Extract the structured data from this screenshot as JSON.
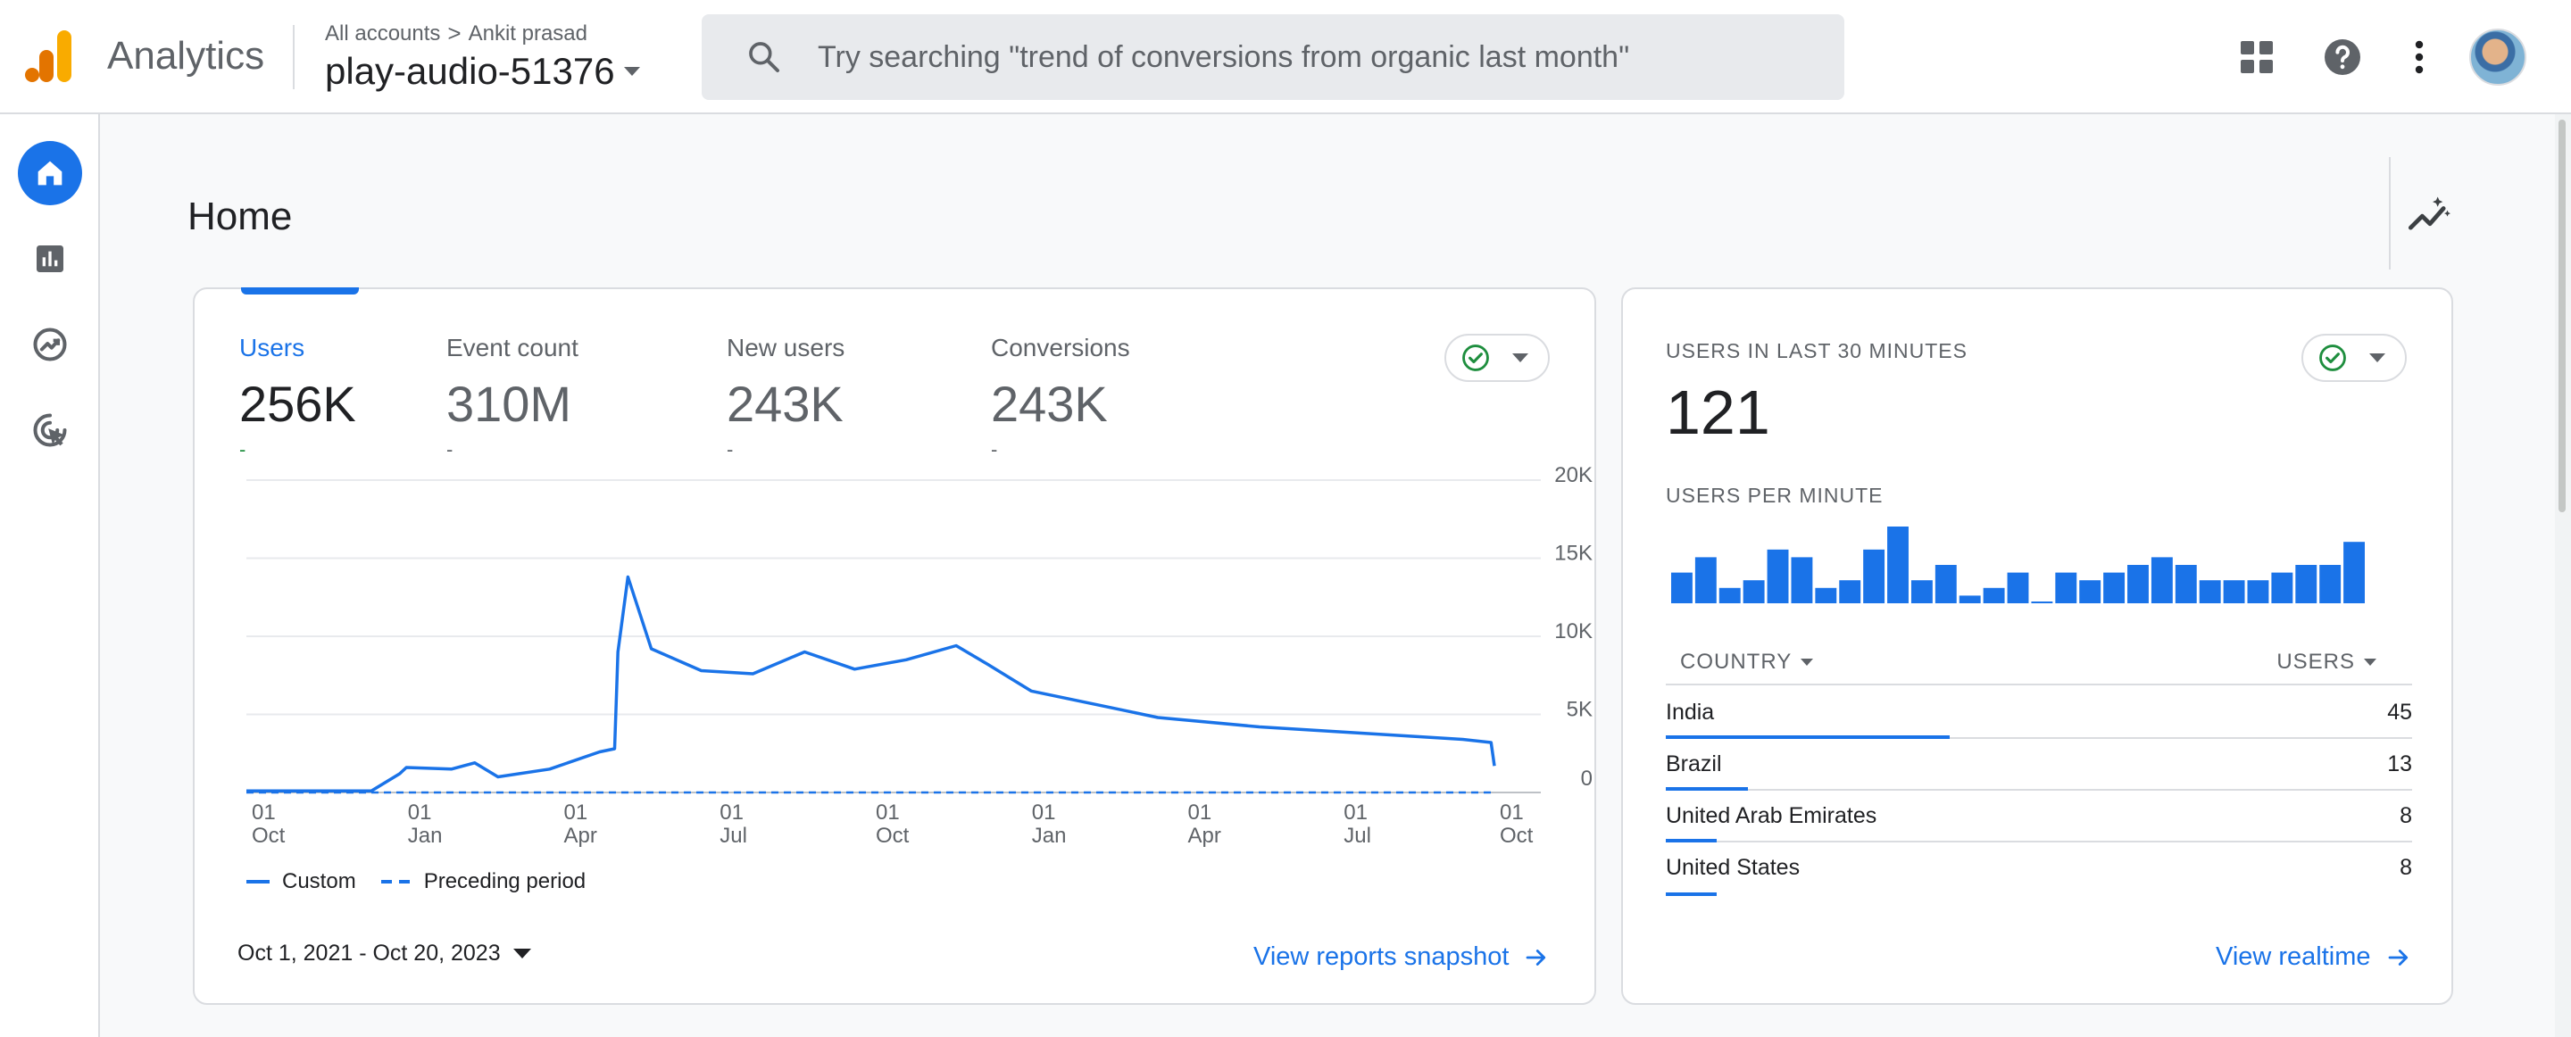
{
  "header": {
    "app_name": "Analytics",
    "breadcrumb": {
      "account": "All accounts",
      "separator": ">",
      "user": "Ankit prasad"
    },
    "property_name": "play-audio-51376",
    "search_placeholder": "Try searching \"trend of conversions from organic last month\"",
    "icons": [
      "apps-grid-icon",
      "help-icon",
      "more-vert-icon",
      "avatar"
    ]
  },
  "rail": {
    "items": [
      {
        "name": "home",
        "icon": "home-icon",
        "active": true
      },
      {
        "name": "reports",
        "icon": "bar-chart-icon",
        "active": false
      },
      {
        "name": "explore",
        "icon": "explore-trend-icon",
        "active": false
      },
      {
        "name": "advertising",
        "icon": "ads-target-icon",
        "active": false
      }
    ]
  },
  "page": {
    "title": "Home"
  },
  "main_card": {
    "metrics": [
      {
        "label": "Users",
        "value": "256K",
        "delta": "-",
        "active": true
      },
      {
        "label": "Event count",
        "value": "310M",
        "delta": "-",
        "active": false
      },
      {
        "label": "New users",
        "value": "243K",
        "delta": "-",
        "active": false
      },
      {
        "label": "Conversions",
        "value": "243K",
        "delta": "-",
        "active": false
      }
    ],
    "legend": {
      "current": "Custom",
      "previous": "Preceding period"
    },
    "date_range": "Oct 1, 2021 - Oct 20, 2023",
    "link": "View reports snapshot"
  },
  "chart_data": {
    "type": "line",
    "title": "",
    "xlabel": "",
    "ylabel": "",
    "x_tick_labels": [
      [
        "01",
        "Oct"
      ],
      [
        "01",
        "Jan"
      ],
      [
        "01",
        "Apr"
      ],
      [
        "01",
        "Jul"
      ],
      [
        "01",
        "Oct"
      ],
      [
        "01",
        "Jan"
      ],
      [
        "01",
        "Apr"
      ],
      [
        "01",
        "Jul"
      ],
      [
        "01",
        "Oct"
      ]
    ],
    "y_tick_labels": [
      "20K",
      "15K",
      "10K",
      "5K",
      "0"
    ],
    "ylim": [
      0,
      20000
    ],
    "grid": true,
    "y_axis_position": "right",
    "legend_position": "bottom-left",
    "series": [
      {
        "name": "Custom",
        "style": "solid",
        "x": [
          "2021-10-01",
          "2021-12-15",
          "2022-01-01",
          "2022-01-05",
          "2022-02-01",
          "2022-02-15",
          "2022-03-01",
          "2022-04-01",
          "2022-05-01",
          "2022-05-10",
          "2022-05-12",
          "2022-05-18",
          "2022-06-01",
          "2022-07-01",
          "2022-08-01",
          "2022-09-01",
          "2022-10-01",
          "2022-11-01",
          "2022-12-01",
          "2022-12-20",
          "2023-01-15",
          "2023-03-01",
          "2023-04-01",
          "2023-06-01",
          "2023-08-01",
          "2023-10-01",
          "2023-10-18",
          "2023-10-20"
        ],
        "values": [
          100,
          100,
          1200,
          1600,
          1500,
          1900,
          1000,
          1500,
          2600,
          2800,
          9000,
          13800,
          9200,
          7800,
          7600,
          9000,
          7900,
          8500,
          9400,
          8200,
          6500,
          5500,
          4800,
          4200,
          3800,
          3400,
          3200,
          1700
        ]
      },
      {
        "name": "Preceding period",
        "style": "dashed",
        "x": [
          "2021-10-01",
          "2023-10-20"
        ],
        "values": [
          0,
          0
        ]
      }
    ]
  },
  "realtime": {
    "title": "USERS IN LAST 30 MINUTES",
    "value": "121",
    "per_minute_label": "USERS PER MINUTE",
    "per_minute_values": [
      4,
      6,
      2,
      3,
      7,
      6,
      2,
      3,
      7,
      10,
      3,
      5,
      1,
      2,
      4,
      0,
      4,
      3,
      4,
      5,
      6,
      5,
      3,
      3,
      3,
      4,
      5,
      5,
      8
    ],
    "table": {
      "col_country": "COUNTRY",
      "col_users": "USERS",
      "rows": [
        {
          "country": "India",
          "users": "45",
          "share": 1.0
        },
        {
          "country": "Brazil",
          "users": "13",
          "share": 0.29
        },
        {
          "country": "United Arab Emirates",
          "users": "8",
          "share": 0.18
        },
        {
          "country": "United States",
          "users": "8",
          "share": 0.18
        }
      ]
    },
    "link": "View realtime"
  },
  "colors": {
    "accent": "#1a73e8",
    "logo_orange": "#f9ab00",
    "logo_dark_orange": "#e37400",
    "check_green": "#1e8e3e",
    "text_secondary": "#5f6368",
    "border": "#dadce0"
  }
}
